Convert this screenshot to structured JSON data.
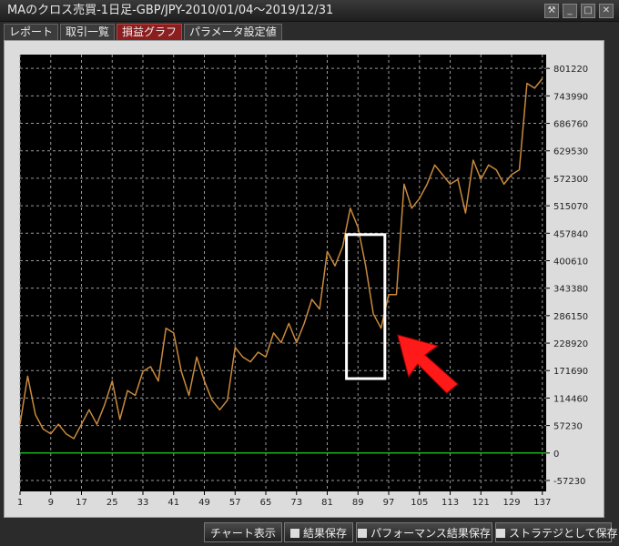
{
  "window": {
    "title": "MAのクロス売買-1日足-GBP/JPY-2010/01/04～2019/12/31",
    "controls": [
      "tool-icon",
      "minimize-icon",
      "maximize-icon",
      "close-icon"
    ]
  },
  "tabs": [
    {
      "label": "レポート",
      "active": false
    },
    {
      "label": "取引一覧",
      "active": false
    },
    {
      "label": "損益グラフ",
      "active": true
    },
    {
      "label": "パラメータ設定値",
      "active": false
    }
  ],
  "buttons": {
    "chart": "チャート表示",
    "save_result": "結果保存",
    "save_perf": "パフォーマンス結果保存",
    "save_strategy": "ストラテジとして保存"
  },
  "chart_data": {
    "type": "line",
    "title": "",
    "xlabel": "",
    "ylabel": "",
    "xlim": [
      1,
      138
    ],
    "ylim": [
      -80000,
      830000
    ],
    "x_ticks": [
      1,
      9,
      17,
      25,
      33,
      41,
      49,
      57,
      65,
      73,
      81,
      89,
      97,
      105,
      113,
      121,
      129,
      137
    ],
    "y_ticks": [
      801220,
      743990,
      686760,
      629530,
      572300,
      515070,
      457840,
      400610,
      343380,
      286150,
      228920,
      171690,
      114460,
      57230,
      0,
      -57230
    ],
    "grid": true,
    "colors": {
      "line": "#c98a3c",
      "zero_line": "#19b419",
      "background": "#000000",
      "grid": "#9a9a9a"
    },
    "series": [
      {
        "values": [
          [
            1,
            60000
          ],
          [
            3,
            160000
          ],
          [
            5,
            80000
          ],
          [
            7,
            50000
          ],
          [
            9,
            40000
          ],
          [
            11,
            60000
          ],
          [
            13,
            40000
          ],
          [
            15,
            30000
          ],
          [
            17,
            60000
          ],
          [
            19,
            90000
          ],
          [
            21,
            60000
          ],
          [
            23,
            100000
          ],
          [
            25,
            150000
          ],
          [
            27,
            70000
          ],
          [
            29,
            130000
          ],
          [
            31,
            120000
          ],
          [
            33,
            170000
          ],
          [
            35,
            180000
          ],
          [
            37,
            150000
          ],
          [
            39,
            260000
          ],
          [
            41,
            250000
          ],
          [
            43,
            170000
          ],
          [
            45,
            120000
          ],
          [
            47,
            200000
          ],
          [
            49,
            150000
          ],
          [
            51,
            110000
          ],
          [
            53,
            90000
          ],
          [
            55,
            110000
          ],
          [
            57,
            220000
          ],
          [
            59,
            200000
          ],
          [
            61,
            190000
          ],
          [
            63,
            210000
          ],
          [
            65,
            200000
          ],
          [
            67,
            250000
          ],
          [
            69,
            230000
          ],
          [
            71,
            270000
          ],
          [
            73,
            230000
          ],
          [
            75,
            270000
          ],
          [
            77,
            320000
          ],
          [
            79,
            300000
          ],
          [
            81,
            420000
          ],
          [
            83,
            390000
          ],
          [
            85,
            430000
          ],
          [
            87,
            510000
          ],
          [
            89,
            470000
          ],
          [
            91,
            390000
          ],
          [
            93,
            290000
          ],
          [
            95,
            260000
          ],
          [
            97,
            330000
          ],
          [
            99,
            330000
          ],
          [
            101,
            560000
          ],
          [
            103,
            510000
          ],
          [
            105,
            530000
          ],
          [
            107,
            560000
          ],
          [
            109,
            600000
          ],
          [
            111,
            580000
          ],
          [
            113,
            560000
          ],
          [
            115,
            570000
          ],
          [
            117,
            500000
          ],
          [
            119,
            610000
          ],
          [
            121,
            570000
          ],
          [
            123,
            600000
          ],
          [
            125,
            590000
          ],
          [
            127,
            560000
          ],
          [
            129,
            580000
          ],
          [
            131,
            590000
          ],
          [
            133,
            770000
          ],
          [
            135,
            760000
          ],
          [
            137,
            780000
          ]
        ]
      }
    ],
    "annotations": [
      {
        "type": "highlight-box",
        "x_range": [
          86,
          96
        ],
        "y_range": [
          155000,
          455000
        ],
        "color": "#ffffff"
      },
      {
        "type": "arrow",
        "color": "#ff1a1a",
        "direction": "up-left"
      }
    ]
  }
}
